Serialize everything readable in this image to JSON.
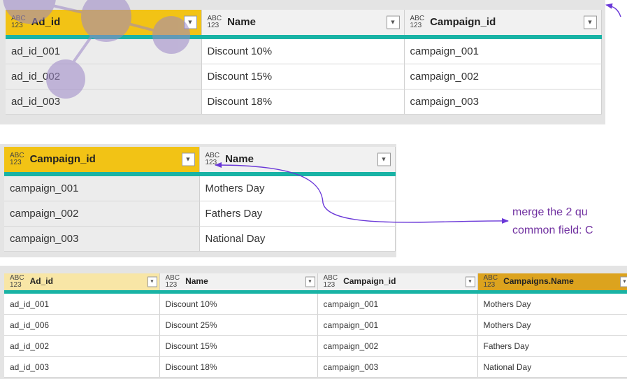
{
  "ads": {
    "headers": [
      {
        "type": "ABC/123",
        "label": "Ad_id"
      },
      {
        "type": "ABC/123",
        "label": "Name"
      },
      {
        "type": "ABC/123",
        "label": "Campaign_id"
      }
    ],
    "rows": [
      [
        "ad_id_001",
        "Discount 10%",
        "campaign_001"
      ],
      [
        "ad_id_002",
        "Discount 15%",
        "campaign_002"
      ],
      [
        "ad_id_003",
        "Discount 18%",
        "campaign_003"
      ]
    ]
  },
  "campaigns": {
    "headers": [
      {
        "type": "ABC/123",
        "label": "Campaign_id"
      },
      {
        "type": "ABC/123",
        "label": "Name"
      }
    ],
    "rows": [
      [
        "campaign_001",
        "Mothers Day"
      ],
      [
        "campaign_002",
        "Fathers Day"
      ],
      [
        "campaign_003",
        "National Day"
      ]
    ]
  },
  "annotation": {
    "line1": "merge the 2 qu",
    "line2": "common field: C"
  },
  "merged": {
    "headers": [
      {
        "type": "ABC/123",
        "label": "Ad_id"
      },
      {
        "type": "ABC/123",
        "label": "Name"
      },
      {
        "type": "ABC/123",
        "label": "Campaign_id"
      },
      {
        "type": "ABC/123",
        "label": "Campaigns.Name"
      }
    ],
    "rows": [
      [
        "ad_id_001",
        "Discount 10%",
        "campaign_001",
        "Mothers Day"
      ],
      [
        "ad_id_006",
        "Discount 25%",
        "campaign_001",
        "Mothers Day"
      ],
      [
        "ad_id_002",
        "Discount 15%",
        "campaign_002",
        "Fathers Day"
      ],
      [
        "ad_id_003",
        "Discount 18%",
        "campaign_003",
        "National Day"
      ]
    ]
  },
  "icons": {
    "type_top": "ABC",
    "type_bottom": "123",
    "dropdown": "▼"
  },
  "colors": {
    "key_header": "#f2c315",
    "merged_key_header": "#f8e6a6",
    "merged_added_header": "#dca31e",
    "header_underline": "#19b3a5",
    "annotation": "#7030a0",
    "bubble": "#9b86c6"
  }
}
